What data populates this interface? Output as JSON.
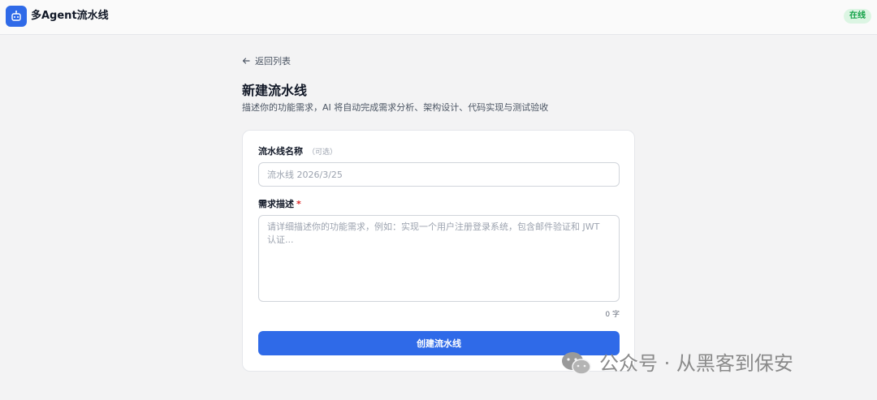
{
  "header": {
    "app_title": "多Agent流水线",
    "status": "在线",
    "logo_icon": "robot-icon"
  },
  "nav": {
    "back_label": "返回列表"
  },
  "page": {
    "title": "新建流水线",
    "subtitle": "描述你的功能需求，AI 将自动完成需求分析、架构设计、代码实现与测试验收"
  },
  "form": {
    "name_label": "流水线名称",
    "name_optional": "（可选）",
    "name_placeholder": "流水线 2026/3/25",
    "name_value": "",
    "desc_label": "需求描述",
    "desc_required_mark": "*",
    "desc_placeholder": "请详细描述你的功能需求，例如：实现一个用户注册登录系统，包含邮件验证和 JWT 认证...",
    "desc_value": "",
    "char_count": "0 字",
    "submit_label": "创建流水线"
  },
  "watermark": {
    "text": "公众号 · 从黑客到保安"
  },
  "colors": {
    "accent": "#2f6ae8",
    "online_bg": "#dcf5e3",
    "online_text": "#16a34a",
    "required": "#dc2626"
  }
}
